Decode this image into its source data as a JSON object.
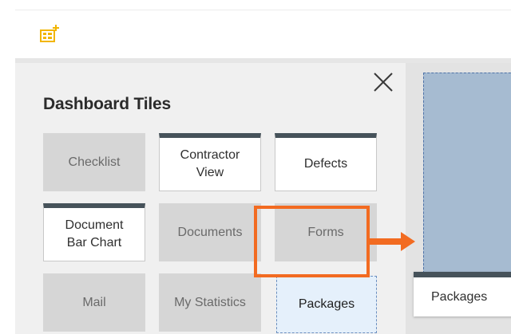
{
  "toolbar": {
    "add_tile_icon": "add-tile-icon",
    "accent": "#f2b500"
  },
  "panel": {
    "title": "Dashboard Tiles",
    "close_icon": "close-icon",
    "tiles": [
      {
        "label": "Checklist",
        "state": "available"
      },
      {
        "label": "Contractor View",
        "state": "added"
      },
      {
        "label": "Defects",
        "state": "added"
      },
      {
        "label": "Document Bar Chart",
        "state": "added"
      },
      {
        "label": "Documents",
        "state": "available"
      },
      {
        "label": "Forms",
        "state": "available"
      },
      {
        "label": "Mail",
        "state": "available"
      },
      {
        "label": "My Statistics",
        "state": "available"
      },
      {
        "label": "Packages",
        "state": "dragging"
      }
    ]
  },
  "canvas": {
    "dragged_tile_label": "Packages"
  },
  "colors": {
    "highlight": "#f26b21",
    "tile_header": "#46525a",
    "drop_zone": "#a6bbd1"
  }
}
